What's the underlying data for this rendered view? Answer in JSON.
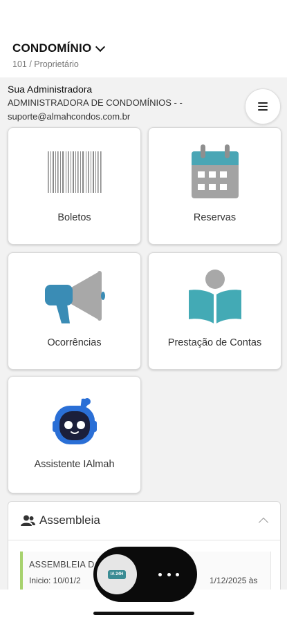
{
  "header": {
    "condo_title": "CONDOMÍNIO",
    "condo_subtitle": "101 / Proprietário"
  },
  "admin": {
    "heading": "Sua Administradora",
    "name": "ADMINISTRADORA DE CONDOMÍNIOS - -",
    "email": "suporte@almahcondos.com.br"
  },
  "tiles": {
    "boletos": {
      "label": "Boletos",
      "icon": "barcode-icon"
    },
    "reservas": {
      "label": "Reservas",
      "icon": "calendar-icon"
    },
    "ocorrencias": {
      "label": "Ocorrências",
      "icon": "megaphone-icon"
    },
    "prestacao": {
      "label": "Prestação de Contas",
      "icon": "reading-book-icon"
    },
    "assistente": {
      "label": "Assistente IAlmah",
      "icon": "robot-icon"
    }
  },
  "assembleia": {
    "title": "Assembleia",
    "item_title": "ASSEMBLEIA D",
    "item_start": "Inicio: 10/01/2",
    "item_end": "1/12/2025 às"
  },
  "floating_bar": {
    "app_thumb_text": "IA 24H"
  },
  "colors": {
    "accent_teal": "#3a8c94",
    "icon_gray": "#9e9e9e",
    "assembleia_border": "#a7d26e",
    "background": "#f2f2f2"
  }
}
